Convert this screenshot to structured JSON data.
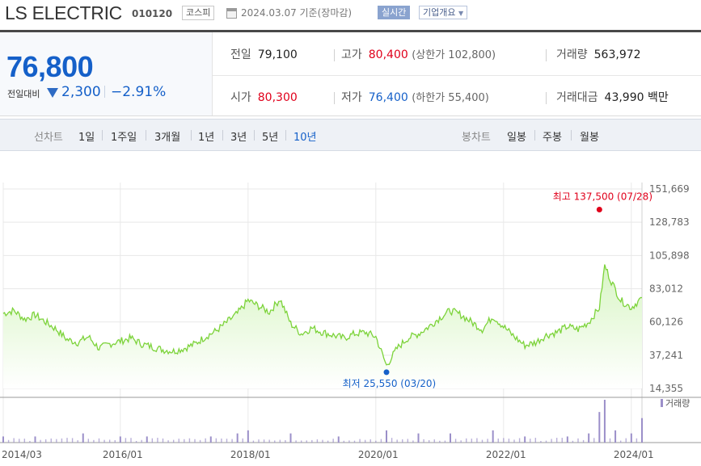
{
  "header": {
    "stock_name": "LS ELECTRIC",
    "stock_code": "010120",
    "market": "코스피",
    "date_text": "2024.03.07  기준(장마감)",
    "realtime_label": "실시간",
    "overview_label": "기업개요",
    "overview_caret": "▼"
  },
  "price": {
    "current": "76,800",
    "change_label": "전일대비",
    "change_value": "2,300",
    "change_pct": "−2.91%"
  },
  "info": {
    "prev_label": "전일",
    "prev_value": "79,100",
    "high_label": "고가",
    "high_value": "80,400",
    "upper_limit": "(상한가 102,800)",
    "volume_label": "거래량",
    "volume_value": "563,972",
    "open_label": "시가",
    "open_value": "80,300",
    "low_label": "저가",
    "low_value": "76,400",
    "lower_limit": "(하한가 55,400)",
    "amount_label": "거래대금",
    "amount_value": "43,990 백만"
  },
  "tabs": {
    "line_label": "선차트",
    "line_periods": [
      "1일",
      "1주일",
      "3개월",
      "1년",
      "3년",
      "5년",
      "10년"
    ],
    "active_period": "10년",
    "candle_label": "봉차트",
    "candle_periods": [
      "일봉",
      "주봉",
      "월봉"
    ]
  },
  "colors": {
    "price_down": "#1560c9",
    "price_up": "#e0001b",
    "line": "#7cd33a",
    "fill_top": "#d8f5c4",
    "volume": "#9b8fc9"
  },
  "chart_data": {
    "type": "area",
    "y_ticks": [
      "151,669",
      "128,783",
      "105,898",
      "83,012",
      "60,126",
      "37,241",
      "14,355"
    ],
    "ylim": [
      14355,
      151669
    ],
    "x_ticks": [
      "2014/03",
      "2016/01",
      "2018/01",
      "2020/01",
      "2022/01",
      "2024/01"
    ],
    "xlim": [
      "2014-03",
      "2024-03"
    ],
    "grid": true,
    "series": [
      {
        "values": [
          [
            "2014-03",
            66000
          ],
          [
            "2014-05",
            68000
          ],
          [
            "2014-07",
            62000
          ],
          [
            "2014-09",
            65000
          ],
          [
            "2014-11",
            60000
          ],
          [
            "2015-01",
            55000
          ],
          [
            "2015-03",
            48000
          ],
          [
            "2015-05",
            46000
          ],
          [
            "2015-07",
            50000
          ],
          [
            "2015-09",
            42000
          ],
          [
            "2015-11",
            45000
          ],
          [
            "2016-01",
            47000
          ],
          [
            "2016-03",
            49000
          ],
          [
            "2016-05",
            45000
          ],
          [
            "2016-07",
            43000
          ],
          [
            "2016-09",
            41000
          ],
          [
            "2016-11",
            40000
          ],
          [
            "2017-01",
            42000
          ],
          [
            "2017-03",
            45000
          ],
          [
            "2017-05",
            50000
          ],
          [
            "2017-07",
            54000
          ],
          [
            "2017-09",
            60000
          ],
          [
            "2017-11",
            66000
          ],
          [
            "2018-01",
            75000
          ],
          [
            "2018-03",
            71000
          ],
          [
            "2018-05",
            67000
          ],
          [
            "2018-07",
            76000
          ],
          [
            "2018-09",
            59000
          ],
          [
            "2018-11",
            52000
          ],
          [
            "2019-01",
            56000
          ],
          [
            "2019-03",
            53000
          ],
          [
            "2019-05",
            51000
          ],
          [
            "2019-07",
            49000
          ],
          [
            "2019-09",
            52000
          ],
          [
            "2019-11",
            53000
          ],
          [
            "2020-01",
            50000
          ],
          [
            "2020-03",
            30000
          ],
          [
            "2020-05",
            42000
          ],
          [
            "2020-07",
            49000
          ],
          [
            "2020-09",
            52000
          ],
          [
            "2020-11",
            57000
          ],
          [
            "2021-01",
            63000
          ],
          [
            "2021-03",
            68000
          ],
          [
            "2021-05",
            65000
          ],
          [
            "2021-07",
            60000
          ],
          [
            "2021-09",
            55000
          ],
          [
            "2021-11",
            64000
          ],
          [
            "2022-01",
            57000
          ],
          [
            "2022-03",
            50000
          ],
          [
            "2022-05",
            44000
          ],
          [
            "2022-07",
            46000
          ],
          [
            "2022-09",
            51000
          ],
          [
            "2022-11",
            53000
          ],
          [
            "2023-01",
            57000
          ],
          [
            "2023-03",
            55000
          ],
          [
            "2023-05",
            60000
          ],
          [
            "2023-07",
            70000
          ],
          [
            "2023-08",
            99000
          ],
          [
            "2023-09",
            90000
          ],
          [
            "2023-11",
            75000
          ],
          [
            "2024-01",
            70000
          ],
          [
            "2024-03",
            76800
          ]
        ]
      }
    ],
    "annotations": [
      {
        "label": "최고 137,500 (07/28)",
        "date": "2023-07",
        "value": 137500,
        "color": "#e0001b"
      },
      {
        "label": "최저 25,550 (03/20)",
        "date": "2020-03",
        "value": 25550,
        "color": "#1560c9"
      }
    ],
    "volume_label": "거래량",
    "volume": [
      [
        "2014-03",
        2
      ],
      [
        "2014-09",
        2
      ],
      [
        "2015-06",
        3
      ],
      [
        "2016-01",
        2
      ],
      [
        "2016-06",
        2
      ],
      [
        "2017-06",
        2
      ],
      [
        "2017-11",
        3
      ],
      [
        "2018-01",
        4
      ],
      [
        "2018-09",
        3
      ],
      [
        "2019-06",
        2
      ],
      [
        "2020-03",
        4
      ],
      [
        "2020-09",
        3
      ],
      [
        "2021-03",
        3
      ],
      [
        "2021-11",
        4
      ],
      [
        "2022-05",
        2
      ],
      [
        "2023-01",
        2
      ],
      [
        "2023-05",
        3
      ],
      [
        "2023-07",
        10
      ],
      [
        "2023-08",
        14
      ],
      [
        "2023-10",
        4
      ],
      [
        "2024-01",
        3
      ],
      [
        "2024-03",
        8
      ]
    ]
  }
}
